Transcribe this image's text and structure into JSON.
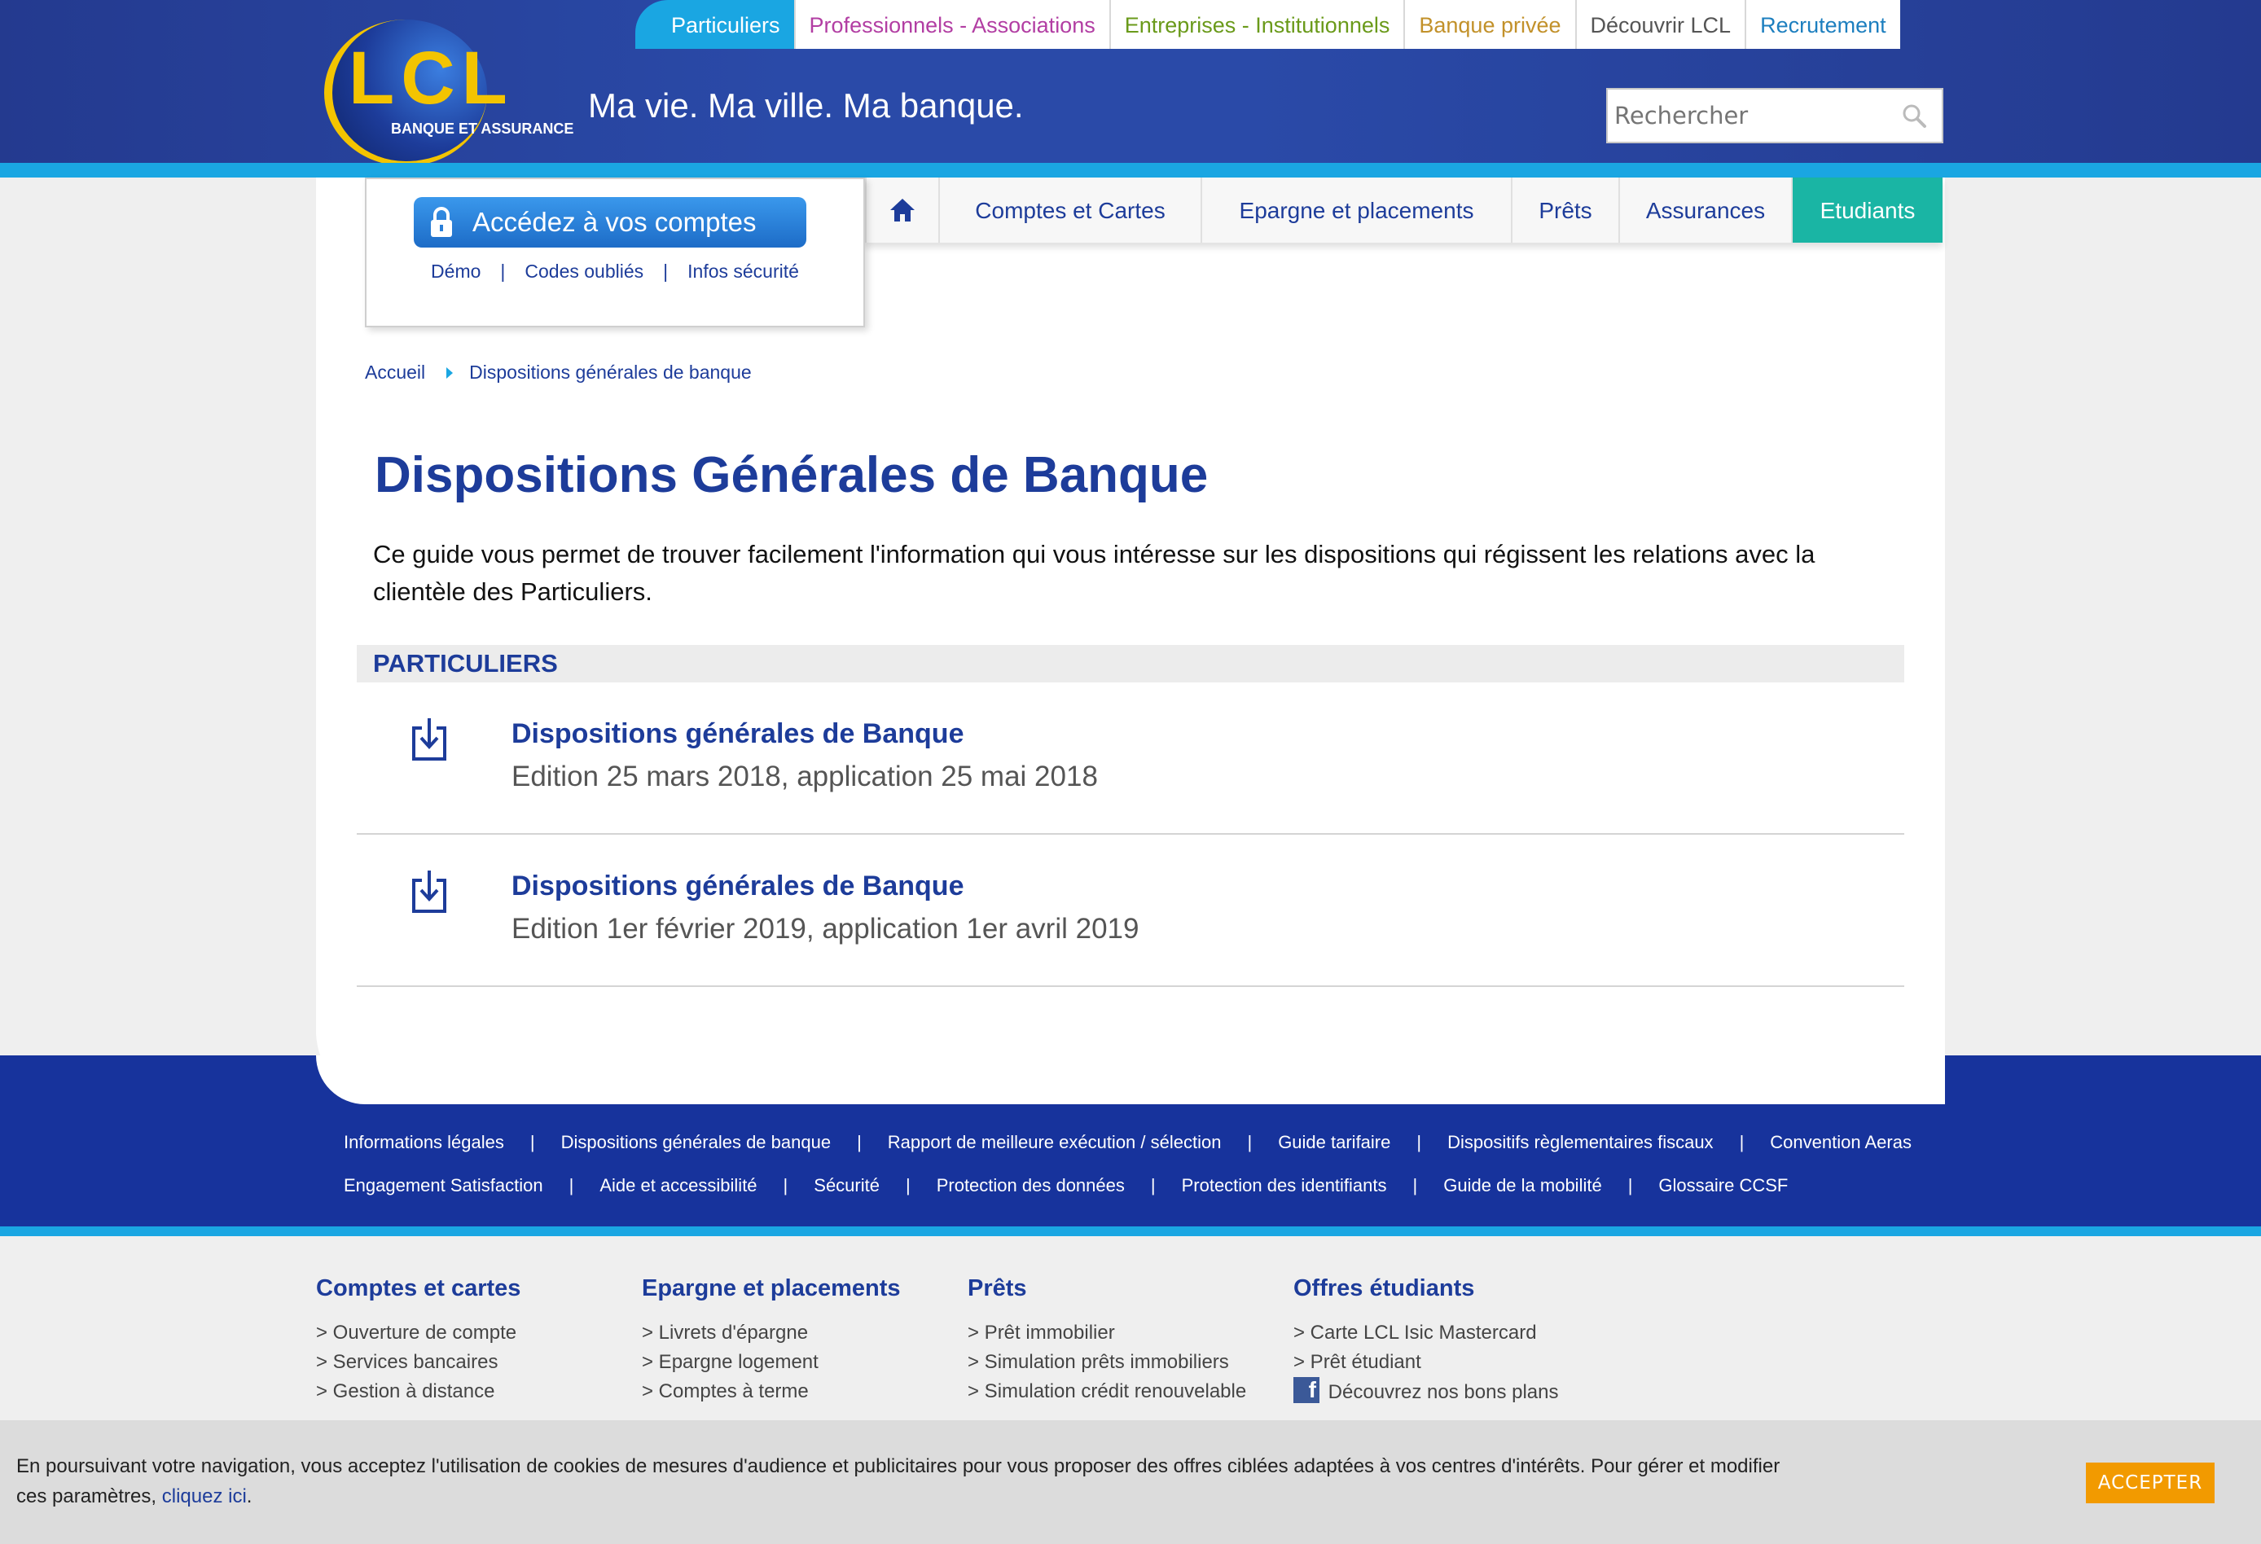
{
  "header": {
    "logo_text": "LCL",
    "logo_sub": "BANQUE ET ASSURANCE",
    "tagline": "Ma vie. Ma ville. Ma banque.",
    "topnav": [
      {
        "label": "Particuliers",
        "color": "#ffffff",
        "active": true
      },
      {
        "label": "Professionnels - Associations",
        "color": "#b23ea3"
      },
      {
        "label": "Entreprises - Institutionnels",
        "color": "#6a9a1a"
      },
      {
        "label": "Banque privée",
        "color": "#c2912a"
      },
      {
        "label": "Découvrir LCL",
        "color": "#555555"
      },
      {
        "label": "Recrutement",
        "color": "#1d7fbf"
      }
    ],
    "search_placeholder": "Rechercher"
  },
  "account": {
    "button_label": "Accédez à vos comptes",
    "links": [
      "Démo",
      "Codes oubliés",
      "Infos sécurité"
    ]
  },
  "mainnav": {
    "items": [
      "Comptes et Cartes",
      "Epargne et placements",
      "Prêts",
      "Assurances",
      "Etudiants"
    ],
    "active": "Etudiants",
    "active_color": "#1ab5a4"
  },
  "breadcrumb": {
    "home": "Accueil",
    "current": "Dispositions générales de banque"
  },
  "content": {
    "title": "Dispositions Générales de Banque",
    "intro": "Ce guide vous permet de trouver facilement l'information qui vous intéresse sur les dispositions qui régissent les relations avec la clientèle des Particuliers.",
    "section": "PARTICULIERS",
    "documents": [
      {
        "title": "Dispositions générales de Banque",
        "subtitle": "Edition 25 mars 2018, application 25 mai 2018"
      },
      {
        "title": "Dispositions générales de Banque",
        "subtitle": "Edition 1er février 2019, application 1er avril 2019"
      }
    ]
  },
  "footer_links": {
    "row1": [
      "Informations légales",
      "Dispositions générales de banque",
      "Rapport de meilleure exécution / sélection",
      "Guide tarifaire",
      "Dispositifs règlementaires fiscaux",
      "Convention Aeras"
    ],
    "row2": [
      "Engagement Satisfaction",
      "Aide et accessibilité",
      "Sécurité",
      "Protection des données",
      "Protection des identifiants",
      "Guide de la mobilité",
      "Glossaire CCSF"
    ]
  },
  "sitemap": [
    {
      "title": "Comptes et cartes",
      "items": [
        "> Ouverture de compte",
        "> Services bancaires",
        "> Gestion à distance"
      ]
    },
    {
      "title": "Epargne et placements",
      "items": [
        "> Livrets d'épargne",
        "> Epargne logement",
        "> Comptes à terme"
      ]
    },
    {
      "title": "Prêts",
      "items": [
        "> Prêt immobilier",
        "> Simulation prêts immobiliers",
        "> Simulation crédit renouvelable"
      ]
    },
    {
      "title": "Offres étudiants",
      "items": [
        "> Carte LCL Isic Mastercard",
        "> Prêt étudiant"
      ],
      "facebook": "Découvrez nos bons plans"
    }
  ],
  "cookie": {
    "text": "En poursuivant votre navigation, vous acceptez l'utilisation de cookies de mesures d'audience et publicitaires pour vous proposer des offres ciblées adaptées à vos centres d'intérêts. Pour gérer et modifier ces paramètres,",
    "link": "cliquez ici",
    "end": ".",
    "button": "ACCEPTER"
  },
  "colors": {
    "brand_blue": "#1d3c9a",
    "header_blue": "#2a4aa8",
    "stripe_cyan": "#1aa6e2",
    "footer_blue": "#17339c",
    "accept_orange": "#f29a00"
  }
}
